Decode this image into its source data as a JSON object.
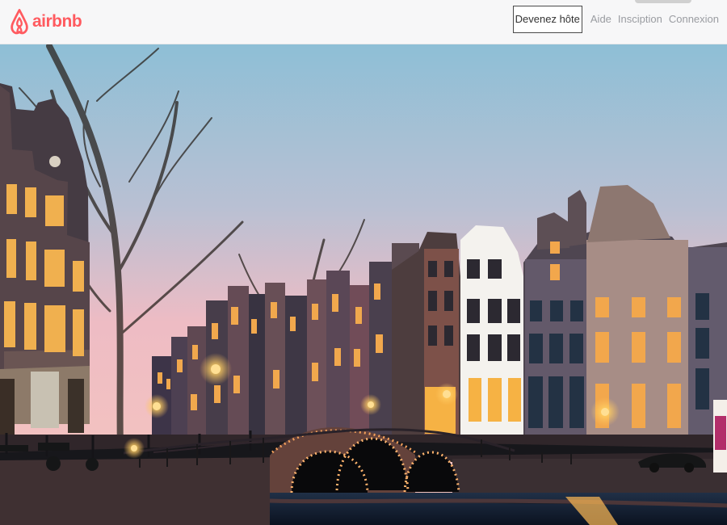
{
  "header": {
    "logo_text": "airbnb",
    "host_button_label": "Devenez hôte",
    "help_link": "Aide",
    "signup_link": "Insciption",
    "login_link": "Connexion"
  },
  "colors": {
    "brand": "#ff5a5f",
    "header_background": "#f7f7f8",
    "nav_text": "#9a9ca1"
  },
  "icons": {
    "logo": "airbnb-belo-icon"
  }
}
